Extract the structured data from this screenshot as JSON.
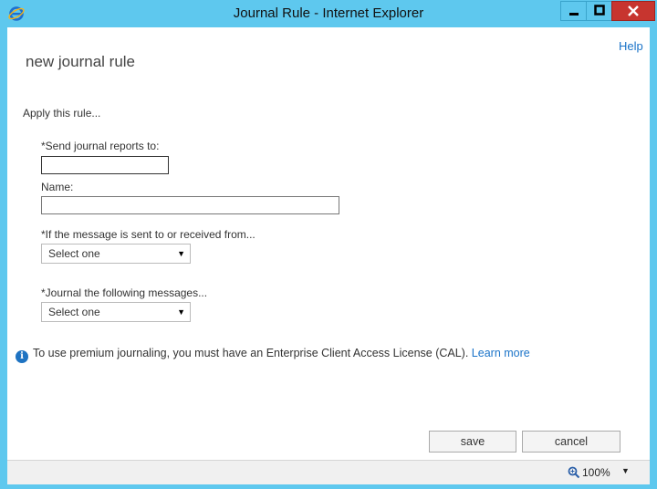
{
  "window": {
    "title": "Journal Rule - Internet Explorer",
    "icon": "ie-icon",
    "controls": {
      "minimize": "minimize-icon",
      "maximize": "maximize-icon",
      "close": "close-icon"
    }
  },
  "page": {
    "help_link": "Help",
    "heading": "new journal rule",
    "intro": "Apply this rule..."
  },
  "form": {
    "send_reports_label": "*Send journal reports to:",
    "send_reports_value": "",
    "name_label": "Name:",
    "name_value": "",
    "sent_to_label": "*If the message is sent to or received from...",
    "sent_to_value": "Select one",
    "journal_label": "*Journal the following messages...",
    "journal_value": "Select one"
  },
  "notice": {
    "icon": "info-icon",
    "text": "To use premium journaling, you must have an Enterprise Client Access License (CAL).",
    "link": "Learn more"
  },
  "buttons": {
    "save": "save",
    "cancel": "cancel"
  },
  "statusbar": {
    "zoom": "100%",
    "zoom_icon": "magnifier-icon"
  },
  "colors": {
    "titlebar": "#5ec8ee",
    "close": "#c7352f",
    "link": "#1a73c8",
    "info": "#1e73c2"
  }
}
